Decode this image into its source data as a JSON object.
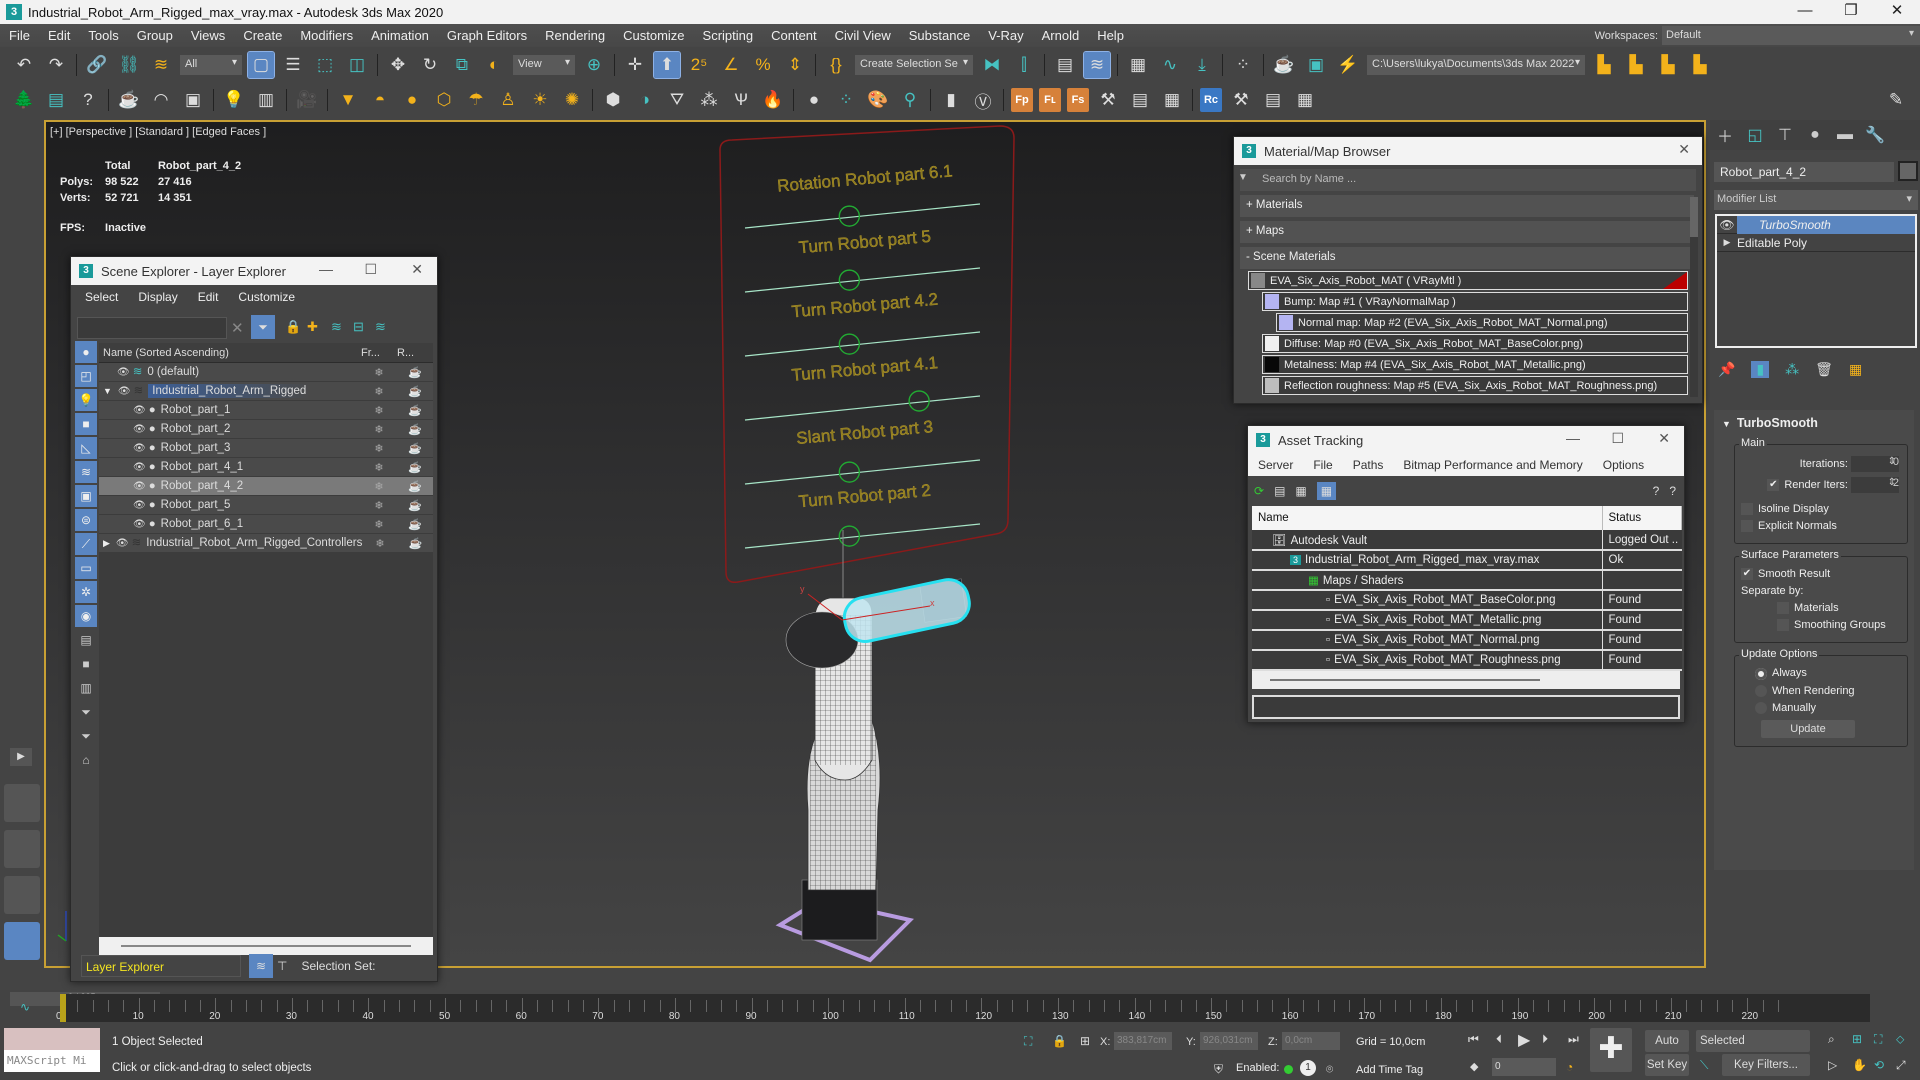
{
  "window": {
    "title": "Industrial_Robot_Arm_Rigged_max_vray.max - Autodesk 3ds Max 2020",
    "app_icon": "3"
  },
  "menu": [
    "File",
    "Edit",
    "Tools",
    "Group",
    "Views",
    "Create",
    "Modifiers",
    "Animation",
    "Graph Editors",
    "Rendering",
    "Customize",
    "Scripting",
    "Content",
    "Civil View",
    "Substance",
    "V-Ray",
    "Arnold",
    "Help"
  ],
  "workspaces": {
    "label": "Workspaces:",
    "value": "Default"
  },
  "toolbar": {
    "selection_filter": "All",
    "ref_coord": "View",
    "selection_set": "Create Selection Se",
    "project_path": "C:\\Users\\lukya\\Documents\\3ds Max 2022"
  },
  "viewport": {
    "label": "[+] [Perspective ] [Standard ] [Edged Faces ]",
    "stats": {
      "col_total": "Total",
      "col_obj": "Robot_part_4_2",
      "polys_label": "Polys:",
      "polys_total": "98 522",
      "polys_obj": "27 416",
      "verts_label": "Verts:",
      "verts_total": "52 721",
      "verts_obj": "14 351",
      "fps_label": "FPS:",
      "fps_value": "Inactive"
    },
    "controls": [
      "Rotation Robot part 6.1",
      "Turn Robot part 5",
      "Turn Robot part 4.2",
      "Turn Robot part 4.1",
      "Slant Robot part 3",
      "Turn Robot part 2"
    ],
    "axis_x": "x",
    "axis_y": "y"
  },
  "scene_explorer": {
    "title": "Scene Explorer - Layer Explorer",
    "menu": [
      "Select",
      "Display",
      "Edit",
      "Customize"
    ],
    "search_value": "",
    "columns": {
      "name": "Name (Sorted Ascending)",
      "freeze": "Fr...",
      "render": "R..."
    },
    "rows": [
      {
        "name": "0 (default)",
        "level": 0,
        "type": "layer-active"
      },
      {
        "name": "Industrial_Robot_Arm_Rigged",
        "level": 0,
        "type": "layer",
        "expanded": true,
        "highlighted": true
      },
      {
        "name": "Robot_part_1",
        "level": 1,
        "type": "object"
      },
      {
        "name": "Robot_part_2",
        "level": 1,
        "type": "object"
      },
      {
        "name": "Robot_part_3",
        "level": 1,
        "type": "object"
      },
      {
        "name": "Robot_part_4_1",
        "level": 1,
        "type": "object"
      },
      {
        "name": "Robot_part_4_2",
        "level": 1,
        "type": "object",
        "selected": true
      },
      {
        "name": "Robot_part_5",
        "level": 1,
        "type": "object"
      },
      {
        "name": "Robot_part_6_1",
        "level": 1,
        "type": "object"
      },
      {
        "name": "Industrial_Robot_Arm_Rigged_Controllers",
        "level": 0,
        "type": "layer",
        "expanded": false
      }
    ],
    "footer": {
      "explorer": "Layer Explorer",
      "selection_set_label": "Selection Set:"
    }
  },
  "material_browser": {
    "title": "Material/Map Browser",
    "search_placeholder": "Search by Name ...",
    "groups": [
      "+ Materials",
      "+ Maps",
      "- Scene Materials"
    ],
    "items": [
      {
        "label": "EVA_Six_Axis_Robot_MAT  ( VRayMtl )",
        "level": 0,
        "swatch": "#888888"
      },
      {
        "label": "Bump: Map #1  ( VRayNormalMap )",
        "level": 1,
        "swatch": "#b4b4f2"
      },
      {
        "label": "Normal map: Map #2 (EVA_Six_Axis_Robot_MAT_Normal.png)",
        "level": 2,
        "swatch": "#b4b4f2"
      },
      {
        "label": "Diffuse: Map #0 (EVA_Six_Axis_Robot_MAT_BaseColor.png)",
        "level": 1,
        "swatch": "#f0f0f0"
      },
      {
        "label": "Metalness: Map #4 (EVA_Six_Axis_Robot_MAT_Metallic.png)",
        "level": 1,
        "swatch": "#080808"
      },
      {
        "label": "Reflection roughness: Map #5 (EVA_Six_Axis_Robot_MAT_Roughness.png)",
        "level": 1,
        "swatch": "#bdbdbd"
      }
    ]
  },
  "asset_tracking": {
    "title": "Asset Tracking",
    "menu": [
      "Server",
      "File",
      "Paths",
      "Bitmap Performance and Memory",
      "Options"
    ],
    "columns": [
      "Name",
      "Status"
    ],
    "rows": [
      {
        "name": "Autodesk Vault",
        "status": "Logged Out ..",
        "level": 0
      },
      {
        "name": "Industrial_Robot_Arm_Rigged_max_vray.max",
        "status": "Ok",
        "level": 1
      },
      {
        "name": "Maps / Shaders",
        "status": "",
        "level": 2
      },
      {
        "name": "EVA_Six_Axis_Robot_MAT_BaseColor.png",
        "status": "Found",
        "level": 3
      },
      {
        "name": "EVA_Six_Axis_Robot_MAT_Metallic.png",
        "status": "Found",
        "level": 3
      },
      {
        "name": "EVA_Six_Axis_Robot_MAT_Normal.png",
        "status": "Found",
        "level": 3
      },
      {
        "name": "EVA_Six_Axis_Robot_MAT_Roughness.png",
        "status": "Found",
        "level": 3
      }
    ]
  },
  "command_panel": {
    "object_name": "Robot_part_4_2",
    "modifier_list": "Modifier List",
    "stack": [
      "TurboSmooth",
      "Editable Poly"
    ],
    "turbosmooth": {
      "title": "TurboSmooth",
      "main_label": "Main",
      "iterations_label": "Iterations:",
      "iterations": "0",
      "render_iters_label": "Render Iters:",
      "render_iters": "2",
      "render_iters_checked": true,
      "isoline_label": "Isoline Display",
      "isoline_checked": false,
      "explicit_normals_label": "Explicit Normals",
      "explicit_normals_checked": false,
      "surface_label": "Surface Parameters",
      "smooth_result_label": "Smooth Result",
      "smooth_result_checked": true,
      "separate_by_label": "Separate by:",
      "materials_label": "Materials",
      "smoothing_groups_label": "Smoothing Groups",
      "update_label": "Update Options",
      "update_options": [
        "Always",
        "When Rendering",
        "Manually"
      ],
      "update_selected": "Always",
      "update_button": "Update"
    }
  },
  "timeline": {
    "frame": "0 / 225",
    "current_frame": "0",
    "ticks": [
      "0",
      "10",
      "20",
      "30",
      "40",
      "50",
      "60",
      "70",
      "80",
      "90",
      "100",
      "110",
      "120",
      "130",
      "140",
      "150",
      "160",
      "170",
      "180",
      "190",
      "200",
      "210",
      "220"
    ]
  },
  "status": {
    "maxscript": "MAXScript Mi",
    "selected": "1 Object Selected",
    "prompt": "Click or click-and-drag to select objects",
    "x_label": "X:",
    "x": "383,817cm",
    "y_label": "Y:",
    "y": "926,031cm",
    "z_label": "Z:",
    "z": "0,0cm",
    "grid": "Grid = 10,0cm",
    "enabled_label": "Enabled:",
    "add_time_tag": "Add Time Tag",
    "frame_value": "0",
    "auto_key": "Auto Key",
    "set_key": "Set Key",
    "key_mode": "Selected",
    "key_filters": "Key Filters..."
  }
}
